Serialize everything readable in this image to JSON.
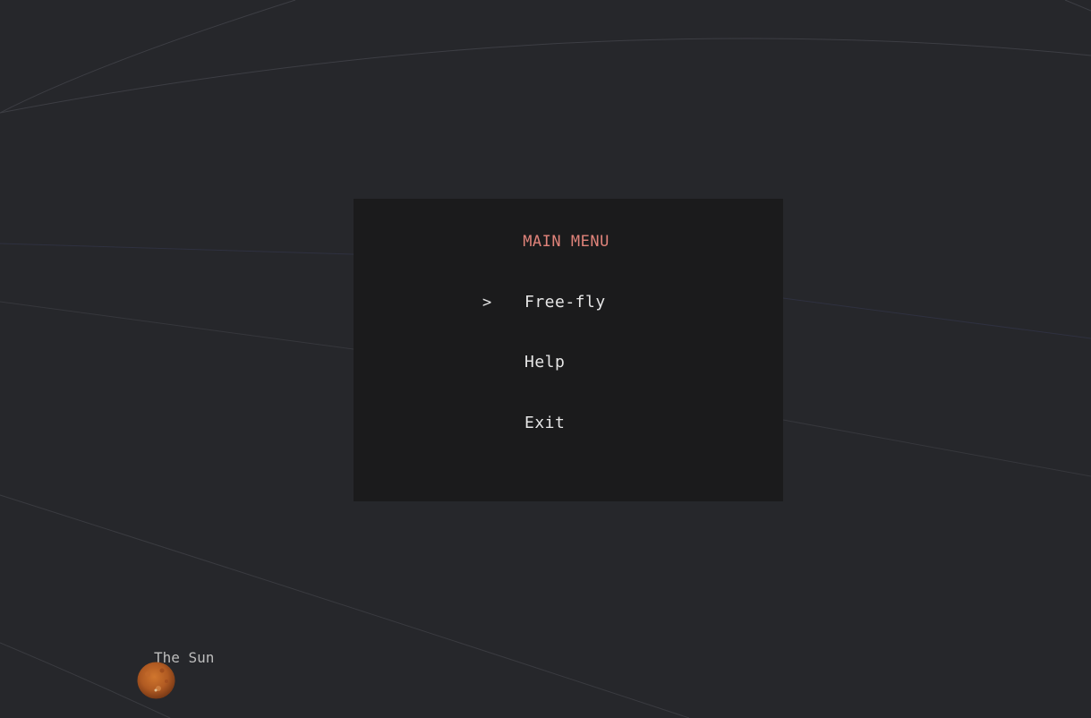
{
  "menu": {
    "title": "MAIN MENU",
    "selected_indicator": ">",
    "selected_index": 0,
    "items": [
      {
        "label": "Free-fly"
      },
      {
        "label": "Help"
      },
      {
        "label": "Exit"
      }
    ]
  },
  "scene": {
    "body_label": "The Sun"
  },
  "colors": {
    "background": "#26272b",
    "panel": "#1b1b1c",
    "title": "#e0837a",
    "menu_text": "#e6e6e6",
    "orbit_line": "#3a3b40",
    "label": "#bdbdbd"
  }
}
